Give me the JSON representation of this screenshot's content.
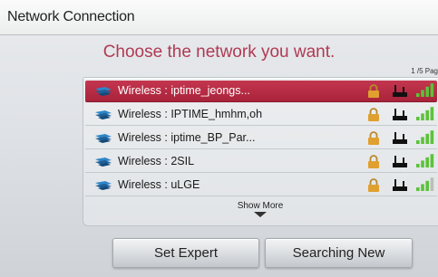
{
  "window": {
    "title": "Network Connection"
  },
  "main": {
    "heading": "Choose the network you want.",
    "page_indicator": "1 /5 Pag",
    "networks": [
      {
        "label": "Wireless : iptime_jeongs...",
        "selected": true,
        "locked": true,
        "signal_bars": 4
      },
      {
        "label": "Wireless : IPTIME_hmhm,oh",
        "selected": false,
        "locked": true,
        "signal_bars": 4
      },
      {
        "label": "Wireless : iptime_BP_Par...",
        "selected": false,
        "locked": true,
        "signal_bars": 4
      },
      {
        "label": "Wireless : 2SIL",
        "selected": false,
        "locked": true,
        "signal_bars": 4
      },
      {
        "label": "Wireless : uLGE",
        "selected": false,
        "locked": true,
        "signal_bars": 3
      }
    ],
    "show_more_label": "Show More"
  },
  "buttons": {
    "set_expert": "Set Expert",
    "searching_new": "Searching New"
  },
  "icons": {
    "network": "wifi-network-icon",
    "lock": "lock-icon",
    "router": "router-icon",
    "signal": "signal-strength-icon",
    "show_more": "chevron-down-icon"
  },
  "colors": {
    "accent": "#b03a53",
    "selected_row": "#b02a42",
    "lock": "#e0a030",
    "signal": "#5cc23a",
    "wifi": "#2e86c8"
  }
}
